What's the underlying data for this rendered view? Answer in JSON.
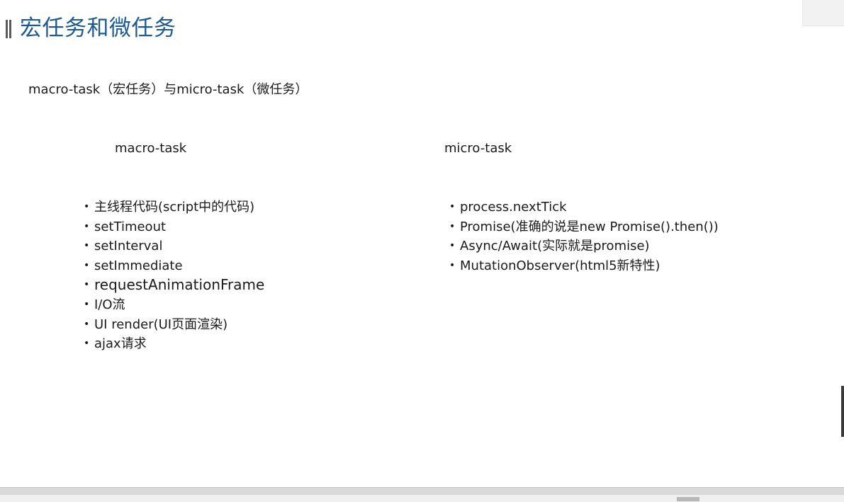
{
  "slide": {
    "title": "宏任务和微任务",
    "subtitle": "macro-task（宏任务）与micro-task（微任务）",
    "bullet_symbol": "•",
    "colors": {
      "title": "#1f5a8f",
      "title_bar": "#5a5a5a",
      "text": "#1a1a1a"
    },
    "macro": {
      "header": "macro-task",
      "items": [
        "主线程代码(script中的代码)",
        "setTimeout",
        "setInterval",
        "setImmediate",
        "requestAnimationFrame",
        "I/O流",
        "UI render(UI页面渲染)",
        "ajax请求"
      ]
    },
    "micro": {
      "header": "micro-task",
      "items": [
        "process.nextTick",
        "Promise(准确的说是new Promise().then())",
        "Async/Await(实际就是promise)",
        "MutationObserver(html5新特性)"
      ]
    }
  }
}
